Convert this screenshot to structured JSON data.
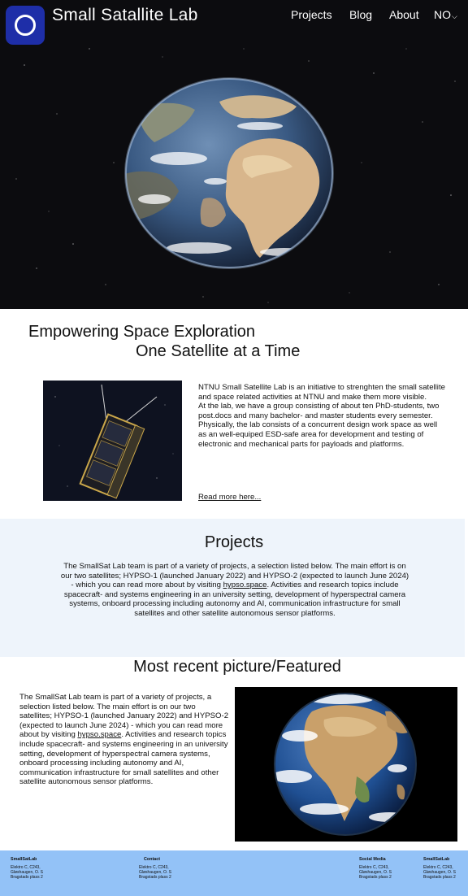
{
  "header": {
    "brand": "Small Satallite Lab",
    "nav": {
      "projects": "Projects",
      "blog": "Blog",
      "about": "About",
      "language": "NO"
    }
  },
  "intro": {
    "tagline_line1": "Empowering Space Exploration",
    "tagline_line2": "One Satellite at a Time",
    "paragraph1": "NTNU Small Satellite Lab is an initiative to strenghten the small satellite and space related activities at NTNU and make them more visible.",
    "paragraph2": "At the lab, we have a group consisting of about ten PhD-students, two post.docs and many bachelor- and master students every semester. Physically, the lab consists of a concurrent design work space as well as an well-equiped ESD-safe area for development and testing of electronic and mechanical parts for payloads and platforms.",
    "read_more": "Read more here..."
  },
  "projects": {
    "title": "Projects",
    "text_before_link": "The SmallSat Lab team is part of a variety of projects, a selection listed below. The main effort is on our two satellites; HYPSO-1 (launched January 2022) and HYPSO-2 (expected to launch June 2024) - which you can read more about by visiting ",
    "link": "hypso.space",
    "text_after_link": ". Activities and research topics include spacecraft- and systems engineering in an university setting, development of hyperspectral camera systems, onboard processing including autonomy and AI, communication infrastructure for small satellites and other satellite autonomous sensor platforms."
  },
  "featured": {
    "title": "Most recent picture/Featured",
    "text_before_link": "The SmallSat Lab team is part of a variety of projects, a selection listed below. The main effort is on our two satellites; HYPSO-1 (launched January 2022) and HYPSO-2 (expected to launch June 2024) - which you can read more about by visiting ",
    "link": "hypso.space",
    "text_after_link": ". Activities and research topics include spacecraft- and systems engineering in an university setting, development of hyperspectral camera systems, onboard processing including autonomy and AI, communication infrastructure for small satellites and other satellite autonomous sensor platforms."
  },
  "footer": {
    "col1": {
      "heading": "SmallSatLab",
      "line1": "Elektro C, C243,",
      "line2": "Gløshaugen, O. S",
      "line3": "Bragstads plass 2"
    },
    "col2": {
      "heading": "Contact",
      "line1": "Elektro C, C243,",
      "line2": "Gløshaugen, O. S",
      "line3": "Bragstads plass 2"
    },
    "col3": {
      "heading": "Social Media",
      "line1": "Elektro C, C243,",
      "line2": "Gløshaugen, O. S",
      "line3": "Bragstads plass 2"
    },
    "col4": {
      "heading": "SmallSatLab",
      "line1": "Elektro C, C243,",
      "line2": "Gløshaugen, O. S",
      "line3": "Bragstads plass 2"
    }
  },
  "colors": {
    "logo": "#1e2ea8",
    "projects_bg": "#eef4fb",
    "footer_bg": "#93c2f7",
    "hero_bg": "#0c0c0f"
  },
  "icons": {
    "logo": "ring-logo-icon",
    "language_dropdown": "chevron-down-icon"
  }
}
